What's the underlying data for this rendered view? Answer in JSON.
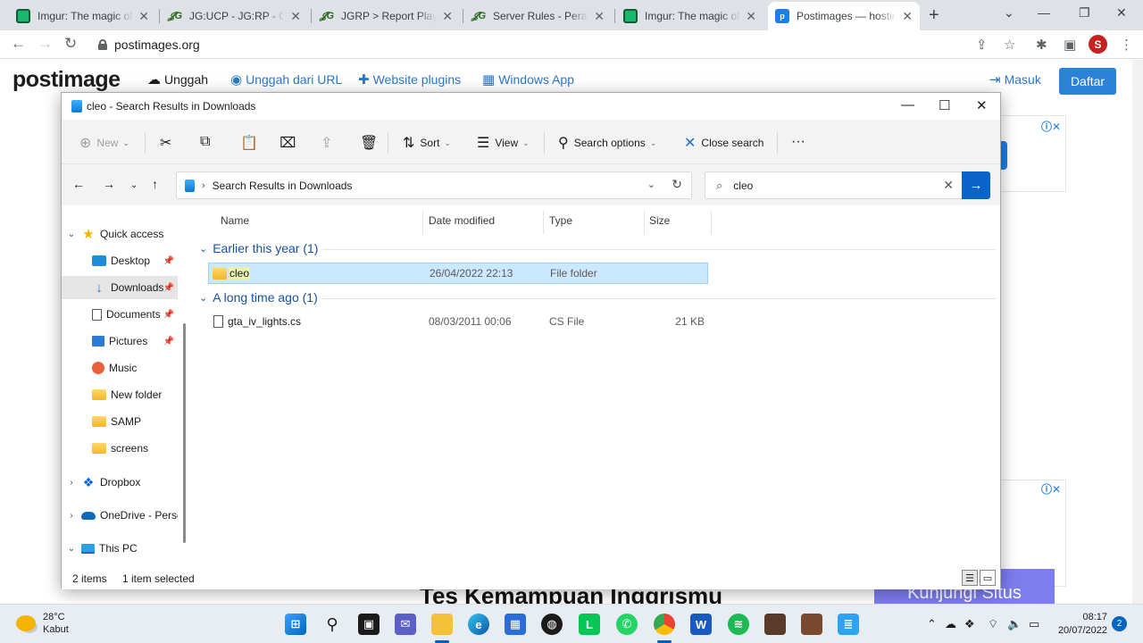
{
  "browser": {
    "tabs": [
      {
        "title": "Imgur: The magic of th",
        "favicon": "imgur-icon"
      },
      {
        "title": "JG:UCP - JG:RP - Chara",
        "favicon": "jg-icon"
      },
      {
        "title": "JGRP > Report Player",
        "favicon": "jg-icon"
      },
      {
        "title": "Server Rules - Peratur",
        "favicon": "jg-icon"
      },
      {
        "title": "Imgur: The magic of th",
        "favicon": "imgur-icon"
      },
      {
        "title": "Postimages — hosting",
        "favicon": "postimages-icon",
        "active": true
      }
    ],
    "url": "postimages.org",
    "profile_initial": "S"
  },
  "site": {
    "logo": "postimage",
    "nav": {
      "upload": "Unggah",
      "upload_url": "Unggah dari URL",
      "plugins": "Website plugins",
      "windows_app": "Windows App",
      "login": "Masuk",
      "register": "Daftar"
    },
    "ad_headline": "Tes Kemampuan Inggrismu",
    "ad_button": "Kunjungi Situs"
  },
  "explorer": {
    "title": "cleo - Search Results in Downloads",
    "commands": {
      "new": "New",
      "sort": "Sort",
      "view": "View",
      "search_options": "Search options",
      "close_search": "Close search"
    },
    "address": "Search Results in Downloads",
    "search_value": "cleo",
    "nav_pane": [
      {
        "label": "Quick access",
        "icon": "star-icon"
      },
      {
        "label": "Desktop",
        "icon": "desktop-icon"
      },
      {
        "label": "Downloads",
        "icon": "download-icon"
      },
      {
        "label": "Documents",
        "icon": "document-icon"
      },
      {
        "label": "Pictures",
        "icon": "pictures-icon"
      },
      {
        "label": "Music",
        "icon": "music-icon"
      },
      {
        "label": "New folder",
        "icon": "folder-icon"
      },
      {
        "label": "SAMP",
        "icon": "folder-icon"
      },
      {
        "label": "screens",
        "icon": "folder-icon"
      },
      {
        "label": "Dropbox",
        "icon": "dropbox-icon"
      },
      {
        "label": "OneDrive - Perso",
        "icon": "onedrive-icon"
      },
      {
        "label": "This PC",
        "icon": "pc-icon"
      }
    ],
    "columns": {
      "name": "Name",
      "date": "Date modified",
      "type": "Type",
      "size": "Size"
    },
    "groups": [
      {
        "label": "Earlier this year (1)",
        "items": [
          {
            "name": "cleo",
            "date": "26/04/2022 22:13",
            "type": "File folder",
            "size": ""
          }
        ]
      },
      {
        "label": "A long time ago (1)",
        "items": [
          {
            "name": "gta_iv_lights.cs",
            "date": "08/03/2011 00:06",
            "type": "CS File",
            "size": "21 KB"
          }
        ]
      }
    ],
    "status": {
      "items": "2 items",
      "selected": "1 item selected"
    }
  },
  "taskbar": {
    "weather_temp": "28°C",
    "weather_desc": "Kabut",
    "time": "08:17",
    "date": "20/07/2022",
    "notifications": "2"
  }
}
